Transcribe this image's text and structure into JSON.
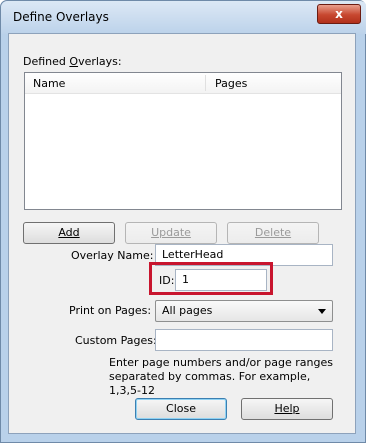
{
  "window": {
    "title": "Define Overlays",
    "close_glyph": "x"
  },
  "overlays_list": {
    "label": "Defined Overlays:",
    "columns": [
      "Name",
      "Pages"
    ],
    "rows": []
  },
  "list_buttons": {
    "add": "Add",
    "update": "Update",
    "delete": "Delete"
  },
  "form": {
    "overlay_name_label": "Overlay Name:",
    "overlay_name_value": "LetterHead",
    "id_label": "ID:",
    "id_value": "1",
    "print_on_pages_label": "Print on Pages:",
    "print_on_pages_value": "All pages",
    "custom_pages_label": "Custom Pages:",
    "custom_pages_value": "",
    "hint_line1": "Enter page numbers and/or page ranges",
    "hint_line2": "separated by commas. For example, 1,3,5-12"
  },
  "footer": {
    "close": "Close",
    "help": "Help"
  },
  "colors": {
    "highlight": "#c8152e",
    "title_close": "#c7472f"
  },
  "icons": {
    "close": "close-icon",
    "dropdown": "chevron-down-icon"
  }
}
